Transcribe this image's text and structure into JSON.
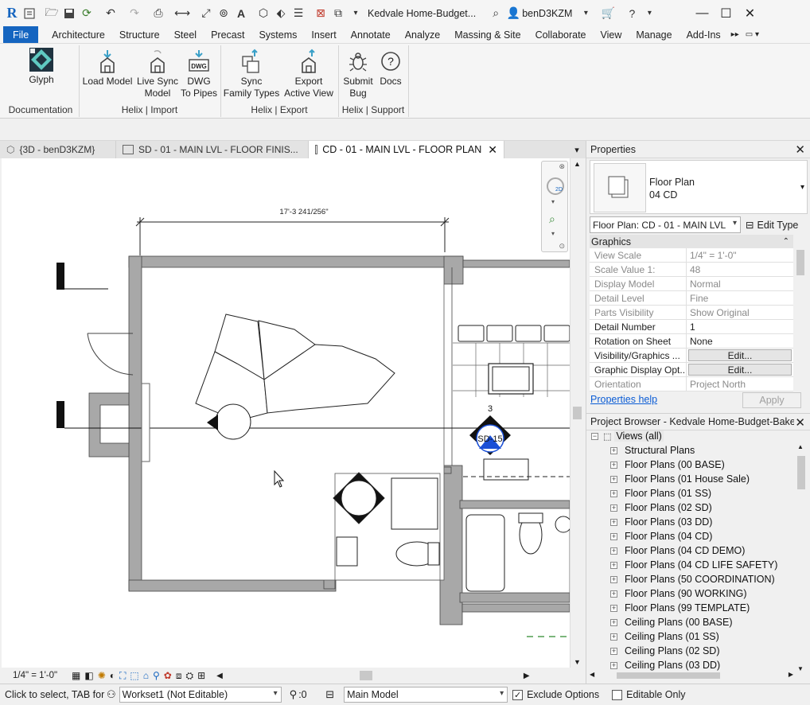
{
  "app": {
    "title": "Kedvale Home-Budget...",
    "user": "benD3KZM"
  },
  "menu_tabs": [
    "File",
    "Architecture",
    "Structure",
    "Steel",
    "Precast",
    "Systems",
    "Insert",
    "Annotate",
    "Analyze",
    "Massing & Site",
    "Collaborate",
    "View",
    "Manage",
    "Add-Ins"
  ],
  "ribbon": {
    "glyph": "Glyph",
    "load_model": "Load Model",
    "live_sync_1": "Live Sync",
    "live_sync_2": "Model",
    "dwg_1": "DWG",
    "dwg_2": "To Pipes",
    "dwg_icon_text": "DWG",
    "sync_1": "Sync",
    "sync_2": "Family Types",
    "export_1": "Export",
    "export_2": "Active View",
    "submit_1": "Submit",
    "submit_2": "Bug",
    "docs": "Docs",
    "group_documentation": "Documentation",
    "group_import": "Helix | Import",
    "group_export": "Helix | Export",
    "group_support": "Helix | Support"
  },
  "view_tabs": [
    {
      "label": "{3D - benD3KZM}"
    },
    {
      "label": "SD - 01 - MAIN LVL - FLOOR FINIS..."
    },
    {
      "label": "CD - 01 - MAIN LVL - FLOOR PLAN"
    }
  ],
  "drawing": {
    "dimension": "17'-3 241/256\"",
    "tag_number": "3",
    "tag_label": "SD-15"
  },
  "view_control": {
    "scale": "1/4\" = 1'-0\""
  },
  "properties": {
    "title": "Properties",
    "type_name": "Floor Plan",
    "type_sub": "04 CD",
    "instance_selector": "Floor Plan: CD - 01 - MAIN LVL -",
    "edit_type": "Edit Type",
    "section": "Graphics",
    "rows": [
      {
        "k": "View Scale",
        "v": "1/4\" = 1'-0\"",
        "ro": true
      },
      {
        "k": "Scale Value    1:",
        "v": "48",
        "ro": true
      },
      {
        "k": "Display Model",
        "v": "Normal",
        "ro": true
      },
      {
        "k": "Detail Level",
        "v": "Fine",
        "ro": true
      },
      {
        "k": "Parts Visibility",
        "v": "Show Original",
        "ro": true
      },
      {
        "k": "Detail Number",
        "v": "1",
        "ro": false
      },
      {
        "k": "Rotation on Sheet",
        "v": "None",
        "ro": false
      },
      {
        "k": "Visibility/Graphics ...",
        "v": "Edit...",
        "ro": false,
        "btn": true
      },
      {
        "k": "Graphic Display Opt...",
        "v": "Edit...",
        "ro": false,
        "btn": true
      },
      {
        "k": "Orientation",
        "v": "Project North",
        "ro": true
      }
    ],
    "help_link": "Properties help",
    "apply": "Apply"
  },
  "browser": {
    "title": "Project Browser - Kedvale Home-Budget-Bake...",
    "root": "Views (all)",
    "items": [
      "Structural Plans",
      "Floor Plans (00 BASE)",
      "Floor Plans (01 House Sale)",
      "Floor Plans (01 SS)",
      "Floor Plans (02 SD)",
      "Floor Plans (03 DD)",
      "Floor Plans (04 CD)",
      "Floor Plans (04 CD DEMO)",
      "Floor Plans (04 CD LIFE SAFETY)",
      "Floor Plans (50 COORDINATION)",
      "Floor Plans (90 WORKING)",
      "Floor Plans (99 TEMPLATE)",
      "Ceiling Plans (00 BASE)",
      "Ceiling Plans (01 SS)",
      "Ceiling Plans (02 SD)",
      "Ceiling Plans (03 DD)"
    ]
  },
  "status": {
    "hint": "Click to select, TAB for a",
    "workset": "Workset1 (Not Editable)",
    "count": ":0",
    "design_option": "Main Model",
    "exclude_options": "Exclude Options",
    "editable_only": "Editable Only"
  },
  "colors": {
    "file_tab": "#1565c0",
    "wall_fill": "#a8a8a8",
    "link": "#0b5cd5"
  }
}
